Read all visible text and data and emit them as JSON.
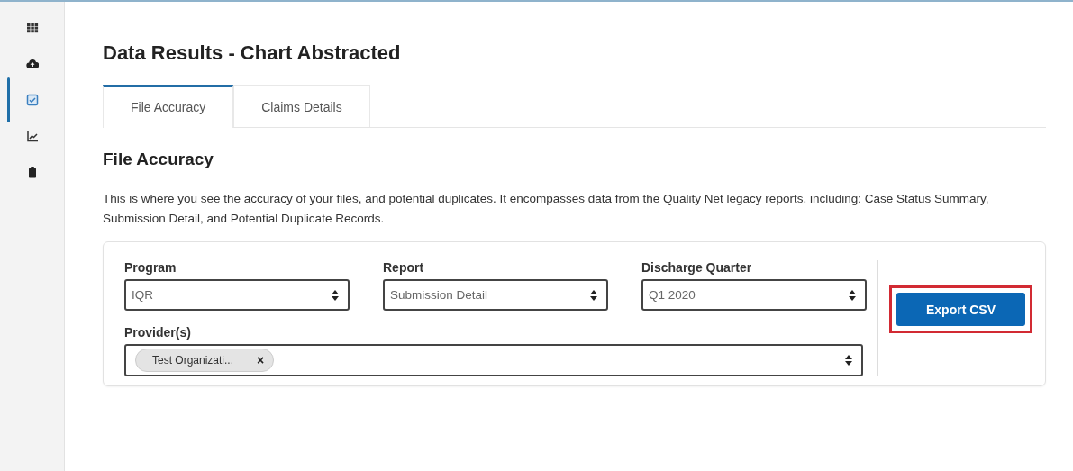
{
  "sidebar": {
    "items": [
      {
        "kind": "grid",
        "selected": false
      },
      {
        "kind": "upload",
        "selected": false
      },
      {
        "kind": "check",
        "selected": true
      },
      {
        "kind": "chart",
        "selected": false
      },
      {
        "kind": "clipboard",
        "selected": false
      }
    ]
  },
  "page_title": "Data Results - Chart Abstracted",
  "tabs": [
    {
      "label": "File Accuracy",
      "selected": true
    },
    {
      "label": "Claims Details",
      "selected": false
    }
  ],
  "section_title": "File Accuracy",
  "description": "This is where you see the accuracy of your files, and potential duplicates. It encompasses data from the Quality Net legacy reports, including: Case Status Summary, Submission Detail, and Potential Duplicate Records.",
  "filters": [
    {
      "label": "Program",
      "value": "IQR"
    },
    {
      "label": "Report",
      "value": "Submission Detail"
    },
    {
      "label": "Discharge Quarter",
      "value": "Q1 2020"
    }
  ],
  "providers": {
    "label": "Provider(s)",
    "chips": [
      {
        "label": "Test Organizati...",
        "remove": "×"
      }
    ]
  },
  "export_button": {
    "label": "Export CSV",
    "highlighted": true
  }
}
